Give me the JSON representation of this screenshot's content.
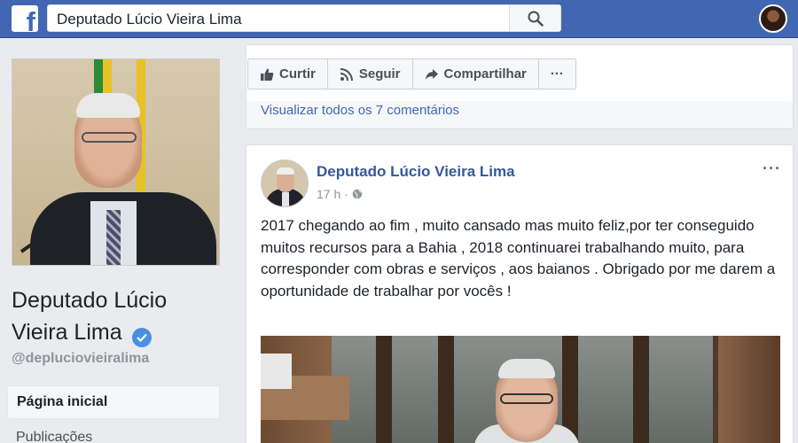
{
  "header": {
    "logo_letter": "f",
    "search_value": "Deputado Lúcio Vieira Lima",
    "colors": {
      "bar": "#4267b2",
      "link": "#365899"
    }
  },
  "sidebar": {
    "page_name": "Deputado Lúcio Vieira Lima",
    "handle": "@depluciovieiralima",
    "nav": [
      {
        "label": "Página inicial",
        "active": true
      },
      {
        "label": "Publicações",
        "active": false
      }
    ]
  },
  "actions": {
    "like": "Curtir",
    "follow": "Seguir",
    "share": "Compartilhar",
    "more": "···",
    "comments_link": "Visualizar todos os 7 comentários"
  },
  "post": {
    "author": "Deputado Lúcio Vieira Lima",
    "time": "17 h",
    "separator": "·",
    "privacy_icon": "globe-icon",
    "more": "···",
    "text": "2017 chegando ao fim , muito cansado mas muito feliz,por ter conseguido muitos recursos para a Bahia , 2018 continuarei trabalhando muito, para corresponder com obras e serviços , aos baianos . Obrigado por me darem a oportunidade de trabalhar por vocês !"
  }
}
